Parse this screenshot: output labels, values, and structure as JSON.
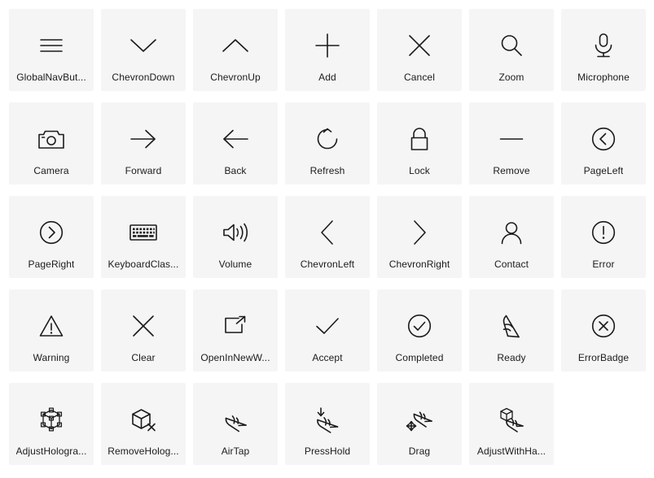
{
  "gallery": {
    "columns": 7,
    "rows": 5,
    "tile_background": "#f5f5f5",
    "page_background": "#ffffff",
    "icon_color": "#1b1b1b",
    "label_color": "#1b1b1b",
    "items": [
      {
        "label": "GlobalNavBut...",
        "icon": "global-nav-button-icon"
      },
      {
        "label": "ChevronDown",
        "icon": "chevron-down-icon"
      },
      {
        "label": "ChevronUp",
        "icon": "chevron-up-icon"
      },
      {
        "label": "Add",
        "icon": "add-icon"
      },
      {
        "label": "Cancel",
        "icon": "cancel-icon"
      },
      {
        "label": "Zoom",
        "icon": "zoom-icon"
      },
      {
        "label": "Microphone",
        "icon": "microphone-icon"
      },
      {
        "label": "Camera",
        "icon": "camera-icon"
      },
      {
        "label": "Forward",
        "icon": "forward-icon"
      },
      {
        "label": "Back",
        "icon": "back-icon"
      },
      {
        "label": "Refresh",
        "icon": "refresh-icon"
      },
      {
        "label": "Lock",
        "icon": "lock-icon"
      },
      {
        "label": "Remove",
        "icon": "remove-icon"
      },
      {
        "label": "PageLeft",
        "icon": "page-left-icon"
      },
      {
        "label": "PageRight",
        "icon": "page-right-icon"
      },
      {
        "label": "KeyboardClas...",
        "icon": "keyboard-classic-icon"
      },
      {
        "label": "Volume",
        "icon": "volume-icon"
      },
      {
        "label": "ChevronLeft",
        "icon": "chevron-left-icon"
      },
      {
        "label": "ChevronRight",
        "icon": "chevron-right-icon"
      },
      {
        "label": "Contact",
        "icon": "contact-icon"
      },
      {
        "label": "Error",
        "icon": "error-icon"
      },
      {
        "label": "Warning",
        "icon": "warning-icon"
      },
      {
        "label": "Clear",
        "icon": "clear-icon"
      },
      {
        "label": "OpenInNewW...",
        "icon": "open-in-new-window-icon"
      },
      {
        "label": "Accept",
        "icon": "accept-icon"
      },
      {
        "label": "Completed",
        "icon": "completed-icon"
      },
      {
        "label": "Ready",
        "icon": "ready-icon"
      },
      {
        "label": "ErrorBadge",
        "icon": "error-badge-icon"
      },
      {
        "label": "AdjustHologra...",
        "icon": "adjust-hologram-icon"
      },
      {
        "label": "RemoveHolog...",
        "icon": "remove-hologram-icon"
      },
      {
        "label": "AirTap",
        "icon": "air-tap-icon"
      },
      {
        "label": "PressHold",
        "icon": "press-hold-icon"
      },
      {
        "label": "Drag",
        "icon": "drag-icon"
      },
      {
        "label": "AdjustWithHa...",
        "icon": "adjust-with-hand-icon"
      }
    ]
  }
}
